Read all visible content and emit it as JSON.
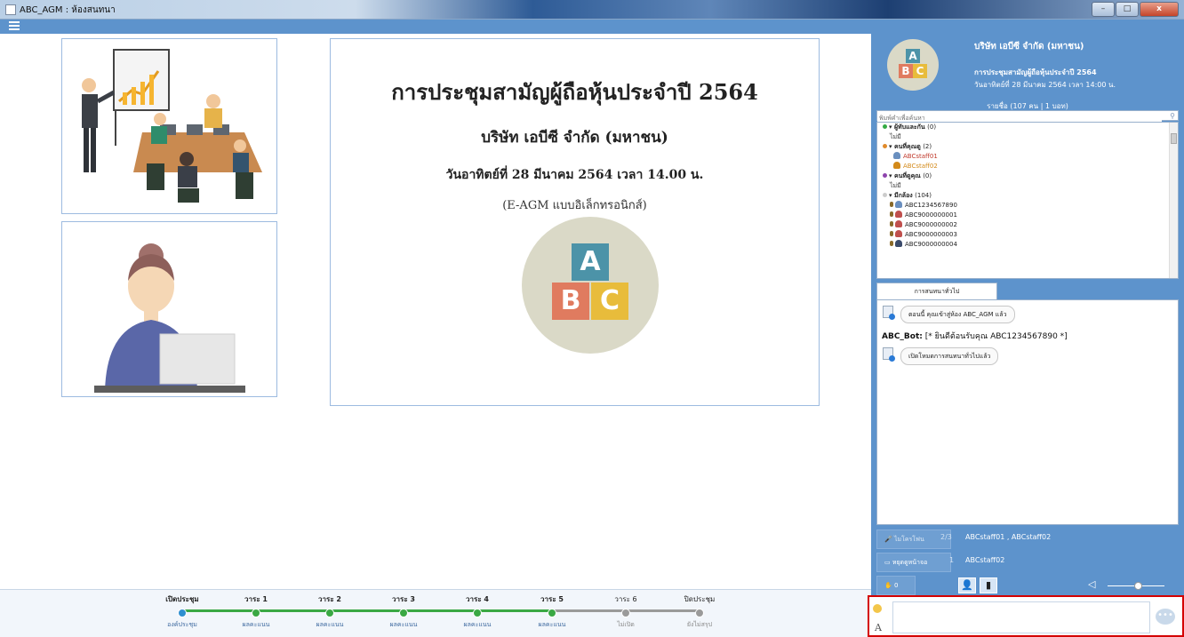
{
  "window": {
    "title": "ABC_AGM : ห้องสนทนา"
  },
  "slide": {
    "title": "การประชุมสามัญผู้ถือหุ้นประจำปี 2564",
    "company": "บริษัท เอบีซี จำกัด (มหาชน)",
    "date": "วันอาทิตย์ที่ 28 มีนาคม 2564 เวลา 14.00 น.",
    "mode": "(E-AGM แบบอิเล็กทรอนิกส์)",
    "logo_letters": [
      "A",
      "B",
      "C"
    ]
  },
  "agenda": {
    "steps": [
      {
        "label": "เปิดประชุม",
        "sub": "องค์ประชุม",
        "state": "current"
      },
      {
        "label": "วาระ 1",
        "sub": "ผลคะแนน",
        "state": "done"
      },
      {
        "label": "วาระ 2",
        "sub": "ผลคะแนน",
        "state": "done"
      },
      {
        "label": "วาระ 3",
        "sub": "ผลคะแนน",
        "state": "done"
      },
      {
        "label": "วาระ 4",
        "sub": "ผลคะแนน",
        "state": "done"
      },
      {
        "label": "วาระ 5",
        "sub": "ผลคะแนน",
        "state": "done"
      },
      {
        "label": "วาระ 6",
        "sub": "ไม่เปิด",
        "state": "pending"
      },
      {
        "label": "ปิดประชุม",
        "sub": "ยังไม่สรุป",
        "state": "pending"
      }
    ]
  },
  "header": {
    "company": "บริษัท เอบีซี จำกัด (มหาชน)",
    "meeting": "การประชุมสามัญผู้ถือหุ้นประจำปี 2564",
    "date": "วันอาทิตย์ที่ 28 มีนาคม 2564 เวลา 14:00 น.",
    "count": "รายชื่อ (107 คน | 1 บอท)"
  },
  "search": {
    "placeholder": "พิมพ์คำเพื่อค้นหา"
  },
  "users": {
    "groups": [
      {
        "name": "ผู้ทับและกัน",
        "count": "(0)",
        "color": "#33aa44",
        "none": "ไม่มี",
        "members": []
      },
      {
        "name": "คนที่คุณดู",
        "count": "(2)",
        "color": "#e08a2a",
        "none": "",
        "members": [
          {
            "name": "ABCstaff01",
            "color": "#c0392b"
          },
          {
            "name": "ABCstaff02",
            "color": "#d38a1a"
          }
        ]
      },
      {
        "name": "คนที่ดูคุณ",
        "count": "(0)",
        "color": "#8e44ad",
        "none": "ไม่มี",
        "members": []
      },
      {
        "name": "มีกล้อง",
        "count": "(104)",
        "color": "#cccccc",
        "none": "",
        "members": [
          {
            "name": "ABC1234567890",
            "color": "#222222"
          },
          {
            "name": "ABC9000000001",
            "color": "#222222"
          },
          {
            "name": "ABC9000000002",
            "color": "#222222"
          },
          {
            "name": "ABC9000000003",
            "color": "#222222"
          },
          {
            "name": "ABC9000000004",
            "color": "#222222"
          }
        ]
      }
    ]
  },
  "chat": {
    "tab": "การสนทนาทั่วไป",
    "msg1": "ตอนนี้ คุณเข้าสู่ห้อง ABC_AGM แล้ว",
    "bot_name": "ABC_Bot:",
    "bot_text": "[* ยินดีต้อนรับคุณ ABC1234567890 *]",
    "msg2": "เปิดโหมดการสนทนาทั่วไปแล้ว"
  },
  "controls": {
    "voice_label": "ไมโครโฟน",
    "voice_count": "2/3",
    "voice_users": "ABCstaff01 , ABCstaff02",
    "screen_label": "หยุดดูหน้าจอ",
    "screen_count": "1",
    "screen_users": "ABCstaff02",
    "hand_count": "0"
  },
  "colors": {
    "panel": "#5d93cc",
    "done": "#3aa844",
    "current": "#2f8fd0",
    "pending": "#9a9a9a",
    "highlight": "#d40000"
  }
}
